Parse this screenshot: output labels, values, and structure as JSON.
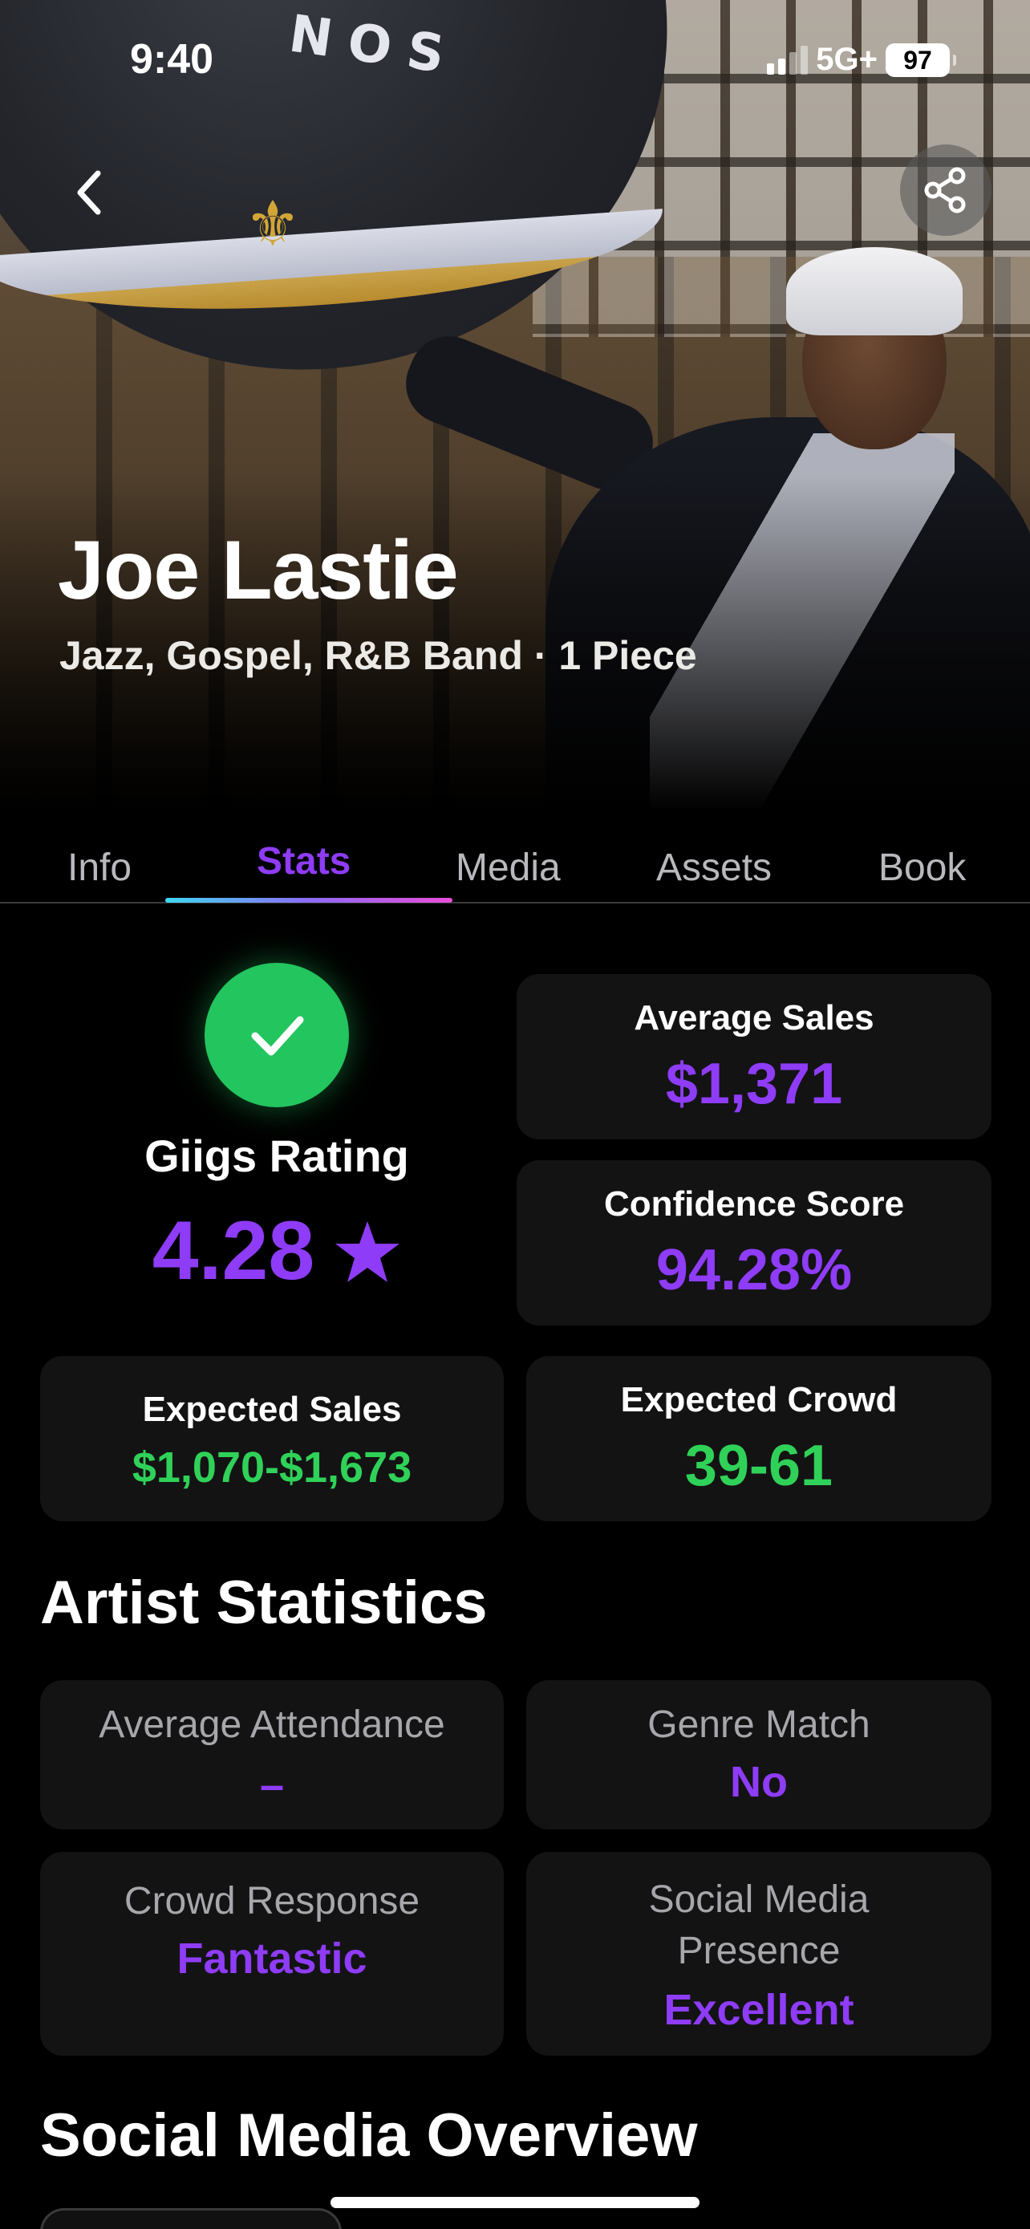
{
  "status_bar": {
    "time": "9:40",
    "network": "5G+",
    "battery": "97"
  },
  "hero": {
    "artist_name": "Joe Lastie",
    "subtitle": "Jazz, Gospel, R&B Band · 1 Piece",
    "back_icon": "chevron-left-icon",
    "share_icon": "share-icon"
  },
  "tabs": [
    {
      "label": "Info",
      "active": false
    },
    {
      "label": "Stats",
      "active": true
    },
    {
      "label": "Media",
      "active": false
    },
    {
      "label": "Assets",
      "active": false
    },
    {
      "label": "Book",
      "active": false
    }
  ],
  "rating": {
    "label": "Giigs Rating",
    "value": "4.28",
    "icon": "star-icon",
    "check_icon": "checkmark-icon"
  },
  "average_sales": {
    "label": "Average Sales",
    "value": "$1,371"
  },
  "confidence_score": {
    "label": "Confidence Score",
    "value": "94.28%"
  },
  "expected_sales": {
    "label": "Expected Sales",
    "value": "$1,070-$1,673"
  },
  "expected_crowd": {
    "label": "Expected Crowd",
    "value": "39-61"
  },
  "artist_statistics": {
    "title": "Artist Statistics",
    "items": [
      {
        "label": "Average Attendance",
        "value": "–"
      },
      {
        "label": "Genre Match",
        "value": "No"
      },
      {
        "label": "Crowd Response",
        "value": "Fantastic"
      },
      {
        "label": "Social Media Presence",
        "value": "Excellent"
      }
    ]
  },
  "social_media_overview": {
    "title": "Social Media Overview"
  },
  "colors": {
    "accent_purple": "#8e3cf7",
    "accent_green": "#30d158",
    "check_green": "#22c55e",
    "card_bg": "#131314"
  }
}
